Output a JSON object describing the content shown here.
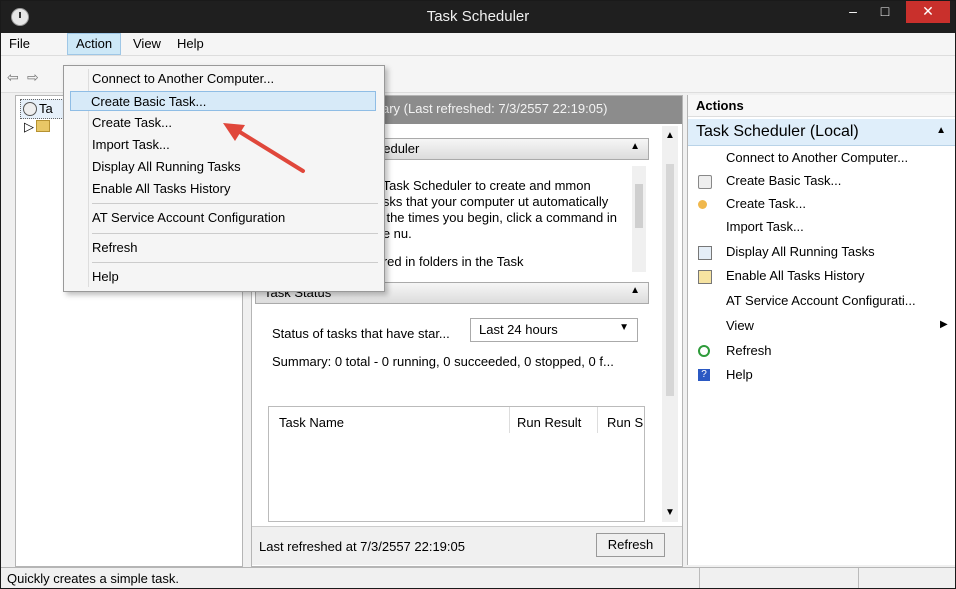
{
  "window": {
    "title": "Task Scheduler",
    "min": "–",
    "max": "□",
    "close": "✕"
  },
  "menu": {
    "file": "File",
    "action": "Action",
    "view": "View",
    "help": "Help"
  },
  "toolbar": {
    "back": "⇦",
    "forward": "⇨"
  },
  "tree": {
    "root": "Ta",
    "expander": "▷"
  },
  "center": {
    "overview_title": "ary (Last refreshed: 7/3/2557 22:19:05)",
    "section1_title": "heduler",
    "section1_desc": "e Task Scheduler to create and mmon tasks that your computer ut automatically at the times you begin, click a command in the nu.",
    "section1_extra": "tored in folders in the Task",
    "status_title": "Task Status",
    "status_label": "Status of tasks that have star...",
    "status_select": "Last 24 hours",
    "summary": "Summary: 0 total - 0 running, 0 succeeded, 0 stopped, 0 f...",
    "table_headers": [
      "Task Name",
      "Run Result",
      "Run S"
    ],
    "last_refreshed": "Last refreshed at 7/3/2557 22:19:05",
    "refresh_button": "Refresh"
  },
  "actions": {
    "header": "Actions",
    "group": "Task Scheduler (Local)",
    "items": [
      {
        "label": "Connect to Another Computer...",
        "icon": "none"
      },
      {
        "label": "Create Basic Task...",
        "icon": "create-basic-task-icon"
      },
      {
        "label": "Create Task...",
        "icon": "create-task-icon"
      },
      {
        "label": "Import Task...",
        "icon": "none"
      },
      {
        "label": "Display All Running Tasks",
        "icon": "running-tasks-icon"
      },
      {
        "label": "Enable All Tasks History",
        "icon": "history-icon"
      },
      {
        "label": "AT Service Account Configurati...",
        "icon": "none"
      },
      {
        "label": "View",
        "icon": "none"
      },
      {
        "label": "Refresh",
        "icon": "refresh-icon"
      },
      {
        "label": "Help",
        "icon": "help-icon"
      }
    ],
    "view_arrow": "▶"
  },
  "dropdown": {
    "items": [
      "Connect to Another Computer...",
      "Create Basic Task...",
      "Create Task...",
      "Import Task...",
      "Display All Running Tasks",
      "Enable All Tasks History",
      "AT Service Account Configuration",
      "Refresh",
      "Help"
    ]
  },
  "statusbar": {
    "text": "Quickly creates a simple task."
  },
  "colors": {
    "titlebar": "#1f1f1f",
    "close": "#c9302c",
    "highlight": "#d7eaf8",
    "annotation_arrow": "#e0473b"
  }
}
